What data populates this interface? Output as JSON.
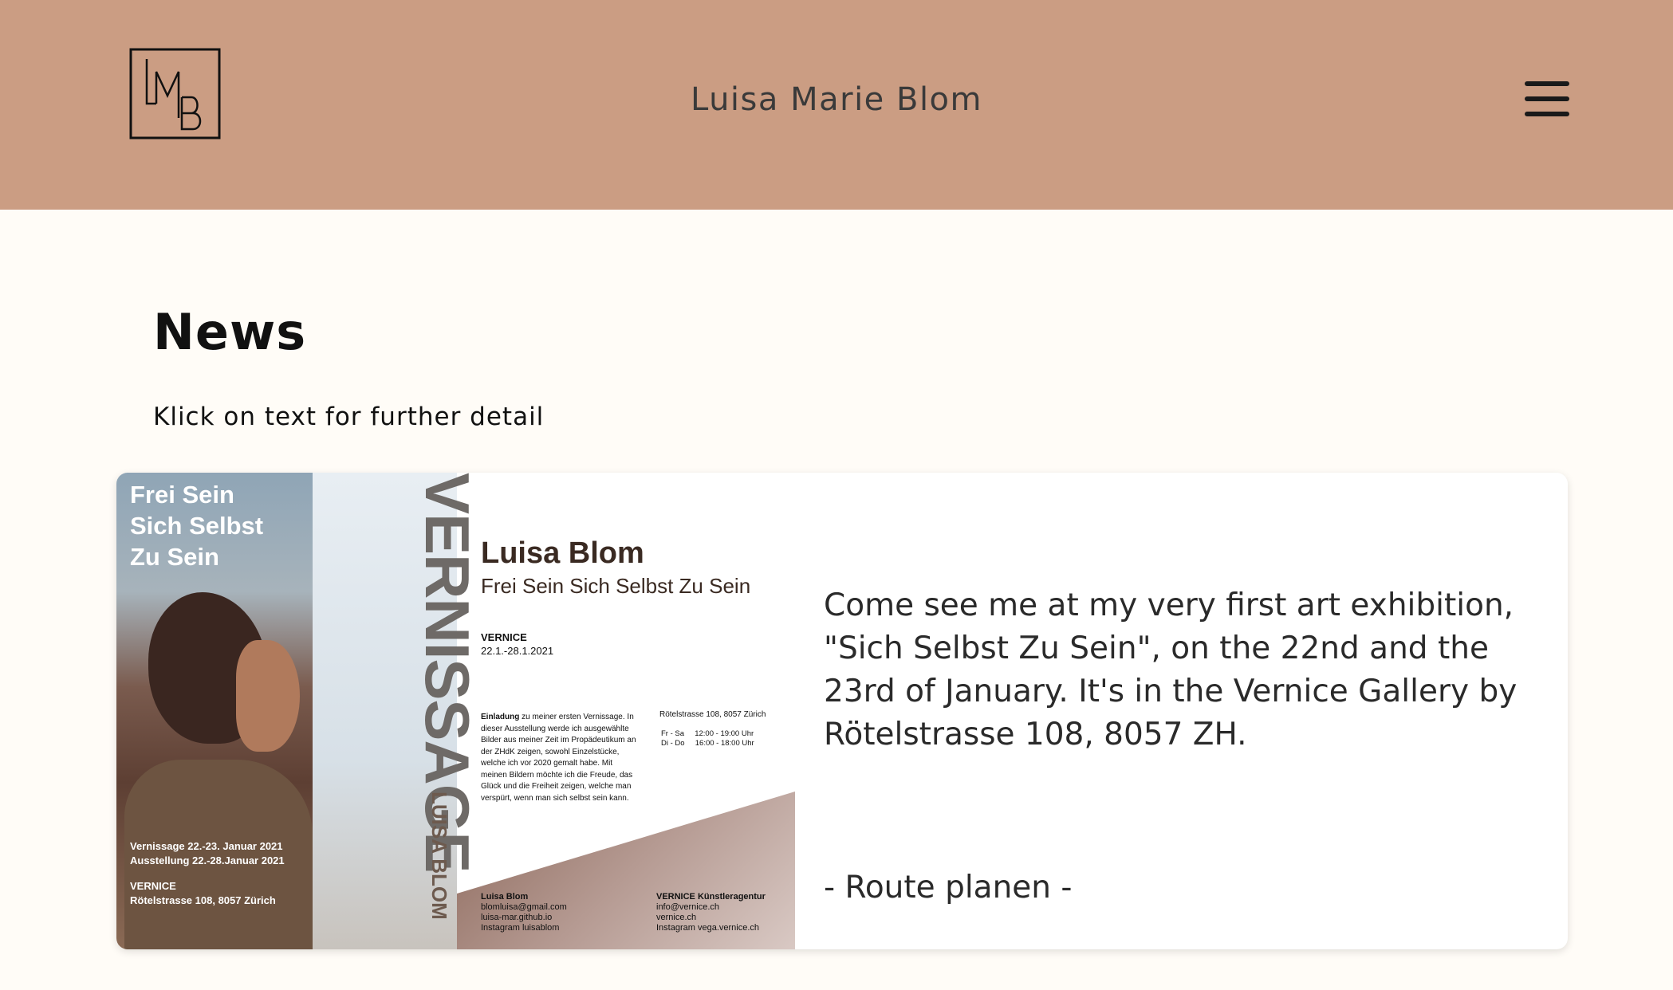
{
  "header": {
    "logo_text": "LMB",
    "site_title": "Luisa Marie Blom",
    "menu_icon": "hamburger-menu-icon",
    "background": "#cb9d83"
  },
  "news": {
    "title": "News",
    "hint": "Klick on text for further detail"
  },
  "card": {
    "description": "Come see me at my very first art exhibition, \"Sich Selbst Zu Sein\", on the 22nd and the 23rd of January. It's in the Vernice Gallery by Rötelstrasse 108, 8057 ZH.",
    "route_link": "- Route planen -",
    "poster": {
      "left_title": "Frei Sein Sich Selbst Zu Sein",
      "left_dates_1": "Vernissage 22.-23. Januar 2021",
      "left_dates_2": "Ausstellung 22.-28.Januar 2021",
      "left_venue_1": "VERNICE",
      "left_venue_2": "Rötelstrasse 108, 8057 Zürich",
      "vertical_big": "VERNISSAGE",
      "vertical_small": "LUISA BLOM",
      "name": "Luisa Blom",
      "subtitle": "Frei Sein Sich Selbst Zu Sein",
      "vernice_label": "VERNICE",
      "vernice_dates": "22.1.-28.1.2021",
      "invitation_lead": "Einladung",
      "invitation_text": "zu meiner ersten Vernissage. In dieser Ausstellung werde ich ausgewählte Bilder aus meiner Zeit im Propädeutikum an der ZHdK zeigen, sowohl Einzelstücke, welche ich vor 2020 gemalt habe. Mit meinen Bildern möchte ich die Freude, das Glück und die Freiheit zeigen, welche man verspürt, wenn man sich selbst sein kann.",
      "address": "Rötelstrasse 108, 8057 Zürich",
      "hours": "Fr - Sa     12:00 - 19:00 Uhr\nDi - Do     16:00 - 18:00 Uhr",
      "footer_left_name": "Luisa Blom",
      "footer_left_1": "blomluisa@gmail.com",
      "footer_left_2": "luisa-mar.github.io",
      "footer_left_3": "Instagram luisablom",
      "footer_right_name": "VERNICE Künstleragentur",
      "footer_right_1": "info@vernice.ch",
      "footer_right_2": "vernice.ch",
      "footer_right_3": "Instagram vega.vernice.ch"
    }
  }
}
